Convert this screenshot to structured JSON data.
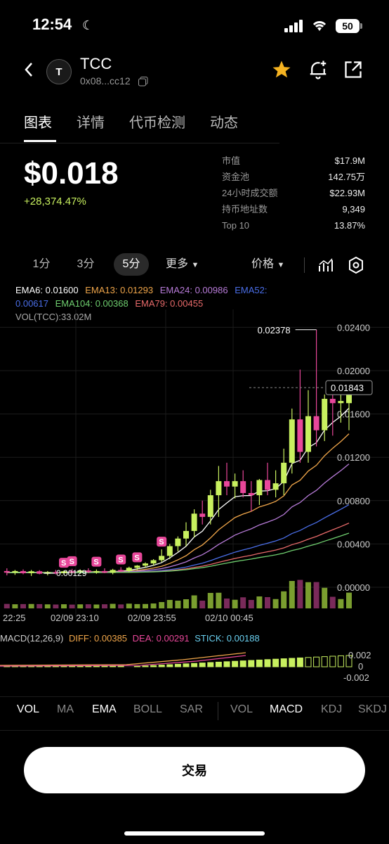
{
  "status": {
    "time": "12:54",
    "battery": "50"
  },
  "header": {
    "token_letter": "T",
    "token_name": "TCC",
    "address": "0x08...cc12"
  },
  "tabs": [
    {
      "label": "图表",
      "active": true
    },
    {
      "label": "详情",
      "active": false
    },
    {
      "label": "代币检测",
      "active": false
    },
    {
      "label": "动态",
      "active": false
    }
  ],
  "price": {
    "value": "$0.018",
    "change": "+28,374.47%"
  },
  "stats": [
    {
      "label": "市值",
      "value": "$17.9M"
    },
    {
      "label": "资金池",
      "value": "142.75万"
    },
    {
      "label": "24小时成交额",
      "value": "$22.93M"
    },
    {
      "label": "持币地址数",
      "value": "9,349"
    },
    {
      "label": "Top 10",
      "value": "13.87%"
    }
  ],
  "timeframes": {
    "t1": "1分",
    "t3": "3分",
    "t5": "5分",
    "more": "更多",
    "price": "价格"
  },
  "ema_legend": {
    "ema6": "EMA6: 0.01600",
    "ema13": "EMA13: 0.01293",
    "ema24": "EMA24: 0.00986",
    "ema52_label": "EMA52:",
    "ema52_value": "0.00617",
    "ema104": "EMA104: 0.00368",
    "ema79": "EMA79: 0.00455",
    "vol": "VOL(TCC):33.02M"
  },
  "chart_data": {
    "type": "candlestick",
    "y_ticks": [
      "0.02400",
      "0.02000",
      "0.01600",
      "0.01200",
      "0.00800",
      "0.00400",
      "0.00000"
    ],
    "ylim": [
      0,
      0.025
    ],
    "current_price_label": "0.01843",
    "high_annotation": "0.02378",
    "low_annotation": "0.00129",
    "x_ticks": [
      "22:25",
      "02/09 23:10",
      "02/09 23:55",
      "02/10 00:45"
    ],
    "candles": [
      {
        "o": 0.0015,
        "h": 0.00175,
        "l": 0.0011,
        "c": 0.00135
      },
      {
        "o": 0.00135,
        "h": 0.0016,
        "l": 0.00115,
        "c": 0.0015
      },
      {
        "o": 0.0015,
        "h": 0.00165,
        "l": 0.0012,
        "c": 0.0013
      },
      {
        "o": 0.0013,
        "h": 0.0016,
        "l": 0.00105,
        "c": 0.00148
      },
      {
        "o": 0.00148,
        "h": 0.00158,
        "l": 0.0012,
        "c": 0.00125
      },
      {
        "o": 0.00125,
        "h": 0.0015,
        "l": 0.0011,
        "c": 0.0014
      },
      {
        "o": 0.0014,
        "h": 0.0016,
        "l": 0.0012,
        "c": 0.0013
      },
      {
        "o": 0.0013,
        "h": 0.00155,
        "l": 0.00115,
        "c": 0.00148
      },
      {
        "o": 0.00148,
        "h": 0.0017,
        "l": 0.0013,
        "c": 0.0014
      },
      {
        "o": 0.0014,
        "h": 0.00165,
        "l": 0.00125,
        "c": 0.00155
      },
      {
        "o": 0.00155,
        "h": 0.00175,
        "l": 0.0013,
        "c": 0.0014
      },
      {
        "o": 0.0014,
        "h": 0.00165,
        "l": 0.00125,
        "c": 0.0015
      },
      {
        "o": 0.0015,
        "h": 0.00175,
        "l": 0.0013,
        "c": 0.00135
      },
      {
        "o": 0.00135,
        "h": 0.0017,
        "l": 0.0012,
        "c": 0.0016
      },
      {
        "o": 0.0016,
        "h": 0.00185,
        "l": 0.0014,
        "c": 0.0015
      },
      {
        "o": 0.0015,
        "h": 0.0019,
        "l": 0.0014,
        "c": 0.0018
      },
      {
        "o": 0.0018,
        "h": 0.00205,
        "l": 0.0016,
        "c": 0.002
      },
      {
        "o": 0.002,
        "h": 0.0023,
        "l": 0.0018,
        "c": 0.0022
      },
      {
        "o": 0.0022,
        "h": 0.0026,
        "l": 0.002,
        "c": 0.0025
      },
      {
        "o": 0.0025,
        "h": 0.0035,
        "l": 0.0023,
        "c": 0.0029
      },
      {
        "o": 0.0029,
        "h": 0.004,
        "l": 0.0026,
        "c": 0.0038
      },
      {
        "o": 0.0038,
        "h": 0.0047,
        "l": 0.0033,
        "c": 0.0045
      },
      {
        "o": 0.0045,
        "h": 0.006,
        "l": 0.0038,
        "c": 0.0052
      },
      {
        "o": 0.0052,
        "h": 0.0072,
        "l": 0.0046,
        "c": 0.0068
      },
      {
        "o": 0.0068,
        "h": 0.008,
        "l": 0.0058,
        "c": 0.0065
      },
      {
        "o": 0.0065,
        "h": 0.009,
        "l": 0.0058,
        "c": 0.0085
      },
      {
        "o": 0.0085,
        "h": 0.0112,
        "l": 0.0065,
        "c": 0.0098
      },
      {
        "o": 0.0098,
        "h": 0.0115,
        "l": 0.0085,
        "c": 0.0093
      },
      {
        "o": 0.0093,
        "h": 0.0105,
        "l": 0.0082,
        "c": 0.0098
      },
      {
        "o": 0.0098,
        "h": 0.0108,
        "l": 0.0083,
        "c": 0.0087
      },
      {
        "o": 0.0087,
        "h": 0.0098,
        "l": 0.007,
        "c": 0.0085
      },
      {
        "o": 0.0085,
        "h": 0.01,
        "l": 0.0076,
        "c": 0.0099
      },
      {
        "o": 0.0099,
        "h": 0.0115,
        "l": 0.0085,
        "c": 0.009
      },
      {
        "o": 0.009,
        "h": 0.0108,
        "l": 0.0083,
        "c": 0.0096
      },
      {
        "o": 0.0096,
        "h": 0.0128,
        "l": 0.0085,
        "c": 0.0115
      },
      {
        "o": 0.0115,
        "h": 0.0165,
        "l": 0.0105,
        "c": 0.0155
      },
      {
        "o": 0.0155,
        "h": 0.0201,
        "l": 0.0115,
        "c": 0.0125
      },
      {
        "o": 0.0125,
        "h": 0.0182,
        "l": 0.0115,
        "c": 0.0158
      },
      {
        "o": 0.0158,
        "h": 0.02378,
        "l": 0.013,
        "c": 0.0145
      },
      {
        "o": 0.0145,
        "h": 0.0178,
        "l": 0.0135,
        "c": 0.0174
      },
      {
        "o": 0.0174,
        "h": 0.0182,
        "l": 0.014,
        "c": 0.017
      },
      {
        "o": 0.017,
        "h": 0.0185,
        "l": 0.0152,
        "c": 0.0172
      },
      {
        "o": 0.017,
        "h": 0.019,
        "l": 0.0145,
        "c": 0.01843
      }
    ],
    "sell_markers": [
      7,
      8,
      11,
      14,
      16,
      19
    ],
    "macd": {
      "label": "MACD(12,26,9)",
      "diff": "DIFF: 0.00385",
      "dea": "DEA: 0.00291",
      "stick": "STICK: 0.00188",
      "ticks": [
        "0.002",
        "0",
        "-0.002"
      ]
    }
  },
  "indicators": [
    "VOL",
    "MA",
    "EMA",
    "BOLL",
    "SAR",
    "VOL",
    "MACD",
    "KDJ",
    "SKDJ"
  ],
  "trade_label": "交易",
  "colors": {
    "up": "#c8f05f",
    "down": "#e8479a",
    "ema6": "#ffffff",
    "ema13": "#f0a64a",
    "ema24": "#b77bd8",
    "ema52": "#4a6ee8",
    "ema79": "#e86a6a",
    "ema104": "#6fcf6f"
  }
}
